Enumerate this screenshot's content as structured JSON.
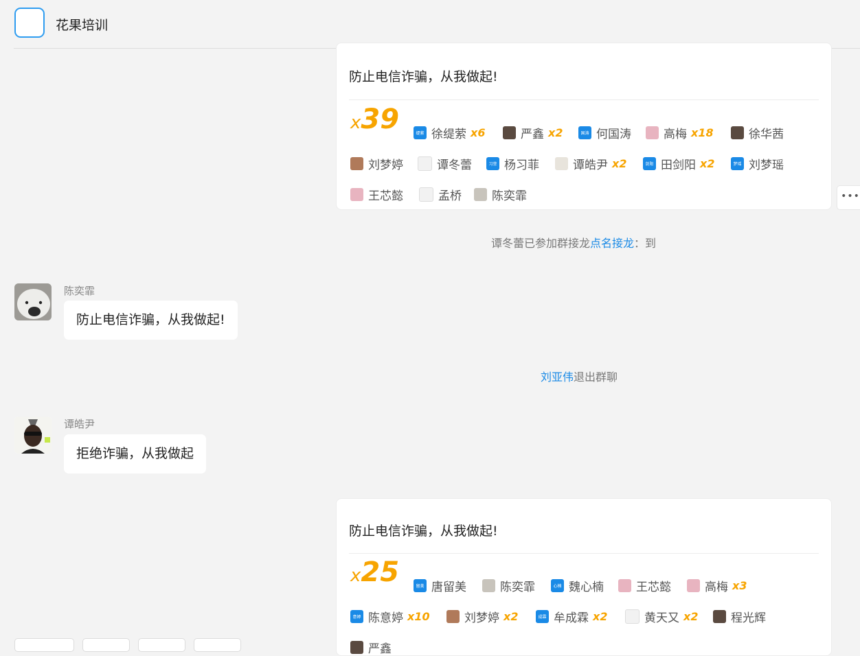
{
  "header": {
    "title": "花果培训"
  },
  "cards": [
    {
      "title": "防止电信诈骗，从我做起!",
      "count_prefix": "x",
      "count": "39",
      "participants": [
        {
          "name": "徐缇萦",
          "mult": "x6",
          "avatar": "blue",
          "tag": "缇萦"
        },
        {
          "name": "严鑫",
          "mult": "x2",
          "avatar": "photo-dark"
        },
        {
          "name": "何国涛",
          "mult": "",
          "avatar": "blue",
          "tag": "国涛"
        },
        {
          "name": "高梅",
          "mult": "x18",
          "avatar": "photo-pink"
        },
        {
          "name": "徐华茜",
          "mult": "",
          "avatar": "photo-dark"
        },
        {
          "name": "刘梦婷",
          "mult": "",
          "avatar": "photo-brown"
        },
        {
          "name": "谭冬蕾",
          "mult": "",
          "avatar": "sketch"
        },
        {
          "name": "杨习菲",
          "mult": "",
          "avatar": "blue",
          "tag": "习菲"
        },
        {
          "name": "谭皓尹",
          "mult": "x2",
          "avatar": "figure"
        },
        {
          "name": "田剑阳",
          "mult": "x2",
          "avatar": "blue",
          "tag": "剑阳"
        },
        {
          "name": "刘梦瑶",
          "mult": "",
          "avatar": "blue",
          "tag": "梦瑶"
        },
        {
          "name": "王芯懿",
          "mult": "",
          "avatar": "photo-pink"
        },
        {
          "name": "孟桥",
          "mult": "",
          "avatar": "sketch"
        },
        {
          "name": "陈奕霏",
          "mult": "",
          "avatar": "photo-grey"
        }
      ]
    },
    {
      "title": "防止电信诈骗，从我做起!",
      "count_prefix": "x",
      "count": "25",
      "participants": [
        {
          "name": "唐留美",
          "mult": "",
          "avatar": "blue",
          "tag": "留美"
        },
        {
          "name": "陈奕霏",
          "mult": "",
          "avatar": "photo-grey"
        },
        {
          "name": "魏心楠",
          "mult": "",
          "avatar": "blue",
          "tag": "心楠"
        },
        {
          "name": "王芯懿",
          "mult": "",
          "avatar": "photo-pink"
        },
        {
          "name": "高梅",
          "mult": "x3",
          "avatar": "photo-pink"
        },
        {
          "name": "陈意婷",
          "mult": "x10",
          "avatar": "blue",
          "tag": "意婷"
        },
        {
          "name": "刘梦婷",
          "mult": "x2",
          "avatar": "photo-brown"
        },
        {
          "name": "牟成霖",
          "mult": "x2",
          "avatar": "blue",
          "tag": "成霖"
        },
        {
          "name": "黄天又",
          "mult": "x2",
          "avatar": "sketch"
        },
        {
          "name": "程光辉",
          "mult": "",
          "avatar": "photo-dark"
        },
        {
          "name": "严鑫",
          "mult": "",
          "avatar": "photo-dark"
        }
      ]
    }
  ],
  "system_messages": {
    "joined_prefix": "谭冬蕾已参加群接龙",
    "joined_link": "点名接龙",
    "joined_suffix": "：到",
    "left_link": "刘亚伟",
    "left_suffix": "退出群聊"
  },
  "messages": [
    {
      "sender": "陈奕霏",
      "text": "防止电信诈骗，从我做起!"
    },
    {
      "sender": "谭皓尹",
      "text": "拒绝诈骗，从我做起"
    }
  ],
  "more_label": "•••",
  "colors": {
    "accent": "#1a8ae6",
    "count": "#f7a400",
    "avatar_blue": "#1a8ae6"
  }
}
